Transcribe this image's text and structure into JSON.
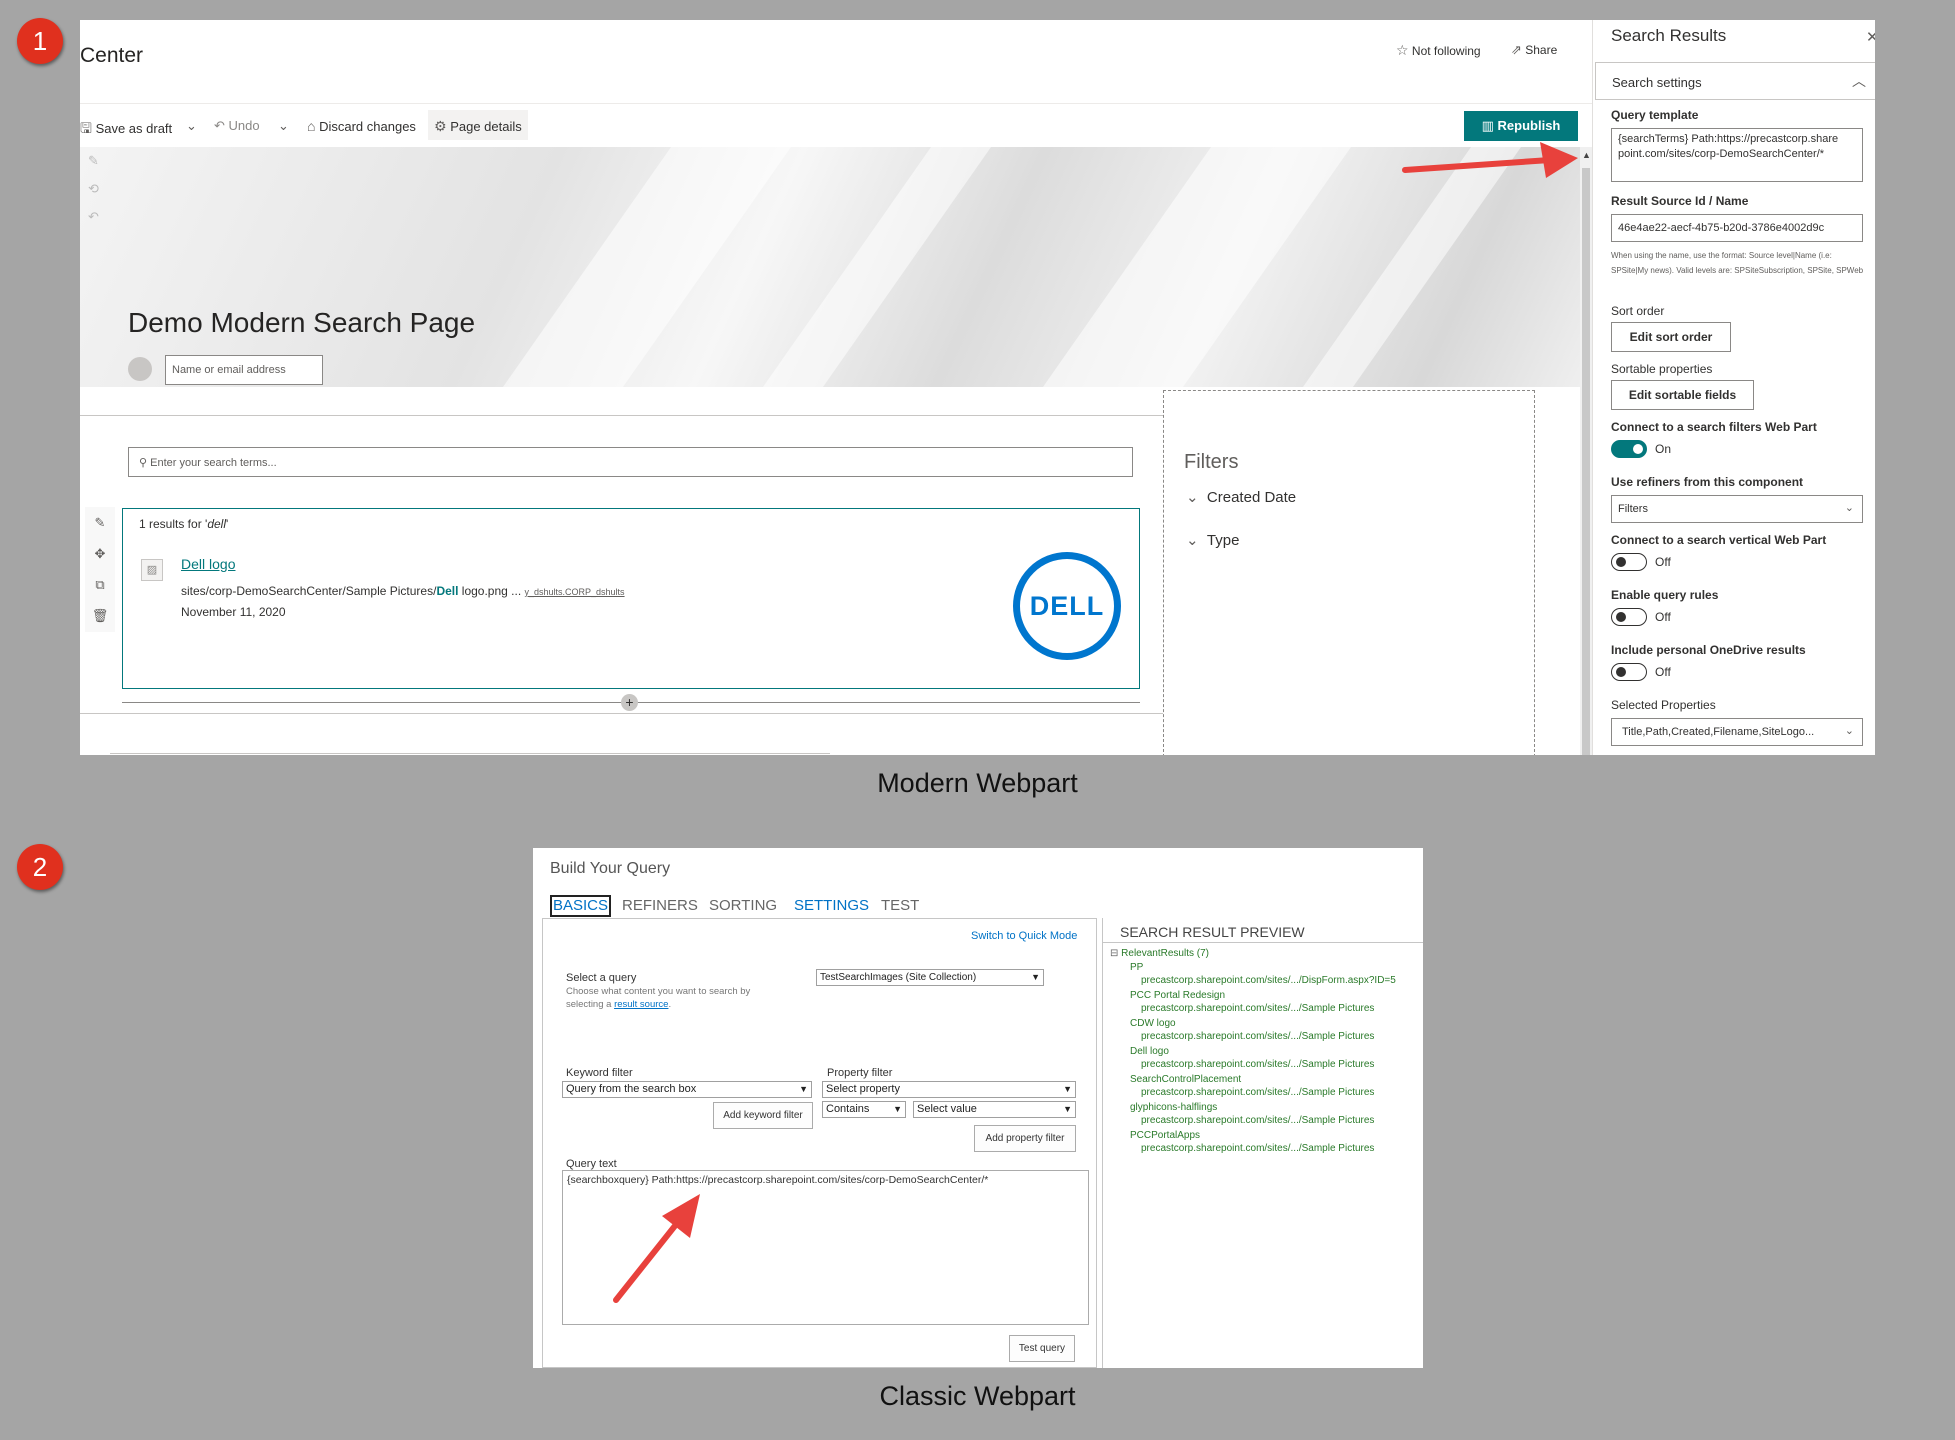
{
  "badges": {
    "one": "1",
    "two": "2"
  },
  "captions": {
    "modern": "Modern Webpart",
    "classic": "Classic Webpart"
  },
  "modern": {
    "site_title": "Center",
    "not_following": "Not following",
    "share": "Share",
    "commands": {
      "save_draft": "Save as draft",
      "undo": "Undo",
      "discard": "Discard changes",
      "page_details": "Page details",
      "republish": "Republish"
    },
    "page_title": "Demo Modern Search Page",
    "author_placeholder": "Name or email address",
    "search_placeholder": "Enter your search terms...",
    "results_count_prefix": "1 results for '",
    "results_query": "dell",
    "results_count_suffix": "'",
    "result": {
      "title": "Dell logo",
      "path_prefix": "sites/corp-DemoSearchCenter/Sample Pictures/",
      "path_bold": "Dell",
      "path_suffix": " logo.png ...",
      "author": "y_dshults.CORP_dshults",
      "date": "November 11, 2020",
      "logo_text": "DELL"
    },
    "filters": {
      "title": "Filters",
      "items": [
        "Created Date",
        "Type"
      ]
    }
  },
  "pane": {
    "title": "Search Results",
    "section": "Search settings",
    "query_template_label": "Query template",
    "query_template_value": "{searchTerms} Path:https://precastcorp.sharepoint.com/sites/corp-DemoSearchCenter/*",
    "result_source_label": "Result Source Id / Name",
    "result_source_value": "46e4ae22-aecf-4b75-b20d-3786e4002d9c",
    "result_source_help": "When using the name, use the format: Source level|Name (i.e: SPSite|My news). Valid levels are: SPSiteSubscription, SPSite, SPWeb",
    "sort_order_label": "Sort order",
    "sort_order_button": "Edit sort order",
    "sortable_label": "Sortable properties",
    "sortable_button": "Edit sortable fields",
    "connect_filters_label": "Connect to a search filters Web Part",
    "connect_filters_state": "On",
    "use_refiners_label": "Use refiners from this component",
    "use_refiners_value": "Filters",
    "connect_vertical_label": "Connect to a search vertical Web Part",
    "connect_vertical_state": "Off",
    "query_rules_label": "Enable query rules",
    "query_rules_state": "Off",
    "onedrive_label": "Include personal OneDrive results",
    "onedrive_state": "Off",
    "selected_props_label": "Selected Properties",
    "selected_props_value": "Title,Path,Created,Filename,SiteLogo..."
  },
  "classic": {
    "title": "Build Your Query",
    "tabs": [
      "BASICS",
      "REFINERS",
      "SORTING",
      "SETTINGS",
      "TEST"
    ],
    "quick_mode": "Switch to Quick Mode",
    "select_query_label": "Select a query",
    "select_query_help_1": "Choose what content you want to search by",
    "select_query_help_2": "selecting a ",
    "result_source_link": "result source",
    "select_query_help_end": ".",
    "select_query_value": "TestSearchImages (Site Collection)",
    "keyword_filter_label": "Keyword filter",
    "keyword_filter_value": "Query from the search box",
    "add_keyword_filter": "Add keyword filter",
    "property_filter_label": "Property filter",
    "property_value": "Select property",
    "operator_value": "Contains",
    "select_value": "Select value",
    "add_property_filter": "Add property filter",
    "query_text_label": "Query text",
    "query_text_value": "{searchboxquery} Path:https://precastcorp.sharepoint.com/sites/corp-DemoSearchCenter/*",
    "test_query": "Test query",
    "preview_title": "SEARCH RESULT PREVIEW",
    "relevant_results": "RelevantResults (7)",
    "results": [
      {
        "title": "PP",
        "url": "precastcorp.sharepoint.com/sites/.../DispForm.aspx?ID=5"
      },
      {
        "title": "PCC Portal Redesign",
        "url": "precastcorp.sharepoint.com/sites/.../Sample Pictures"
      },
      {
        "title": "CDW logo",
        "url": "precastcorp.sharepoint.com/sites/.../Sample Pictures"
      },
      {
        "title": "Dell logo",
        "url": "precastcorp.sharepoint.com/sites/.../Sample Pictures"
      },
      {
        "title": "SearchControlPlacement",
        "url": "precastcorp.sharepoint.com/sites/.../Sample Pictures"
      },
      {
        "title": "glyphicons-halflings",
        "url": "precastcorp.sharepoint.com/sites/.../Sample Pictures"
      },
      {
        "title": "PCCPortalApps",
        "url": "precastcorp.sharepoint.com/sites/.../Sample Pictures"
      }
    ]
  },
  "colors": {
    "teal": "#03787c",
    "arrow": "#e8413c",
    "tree_green": "#2a7a2a"
  }
}
